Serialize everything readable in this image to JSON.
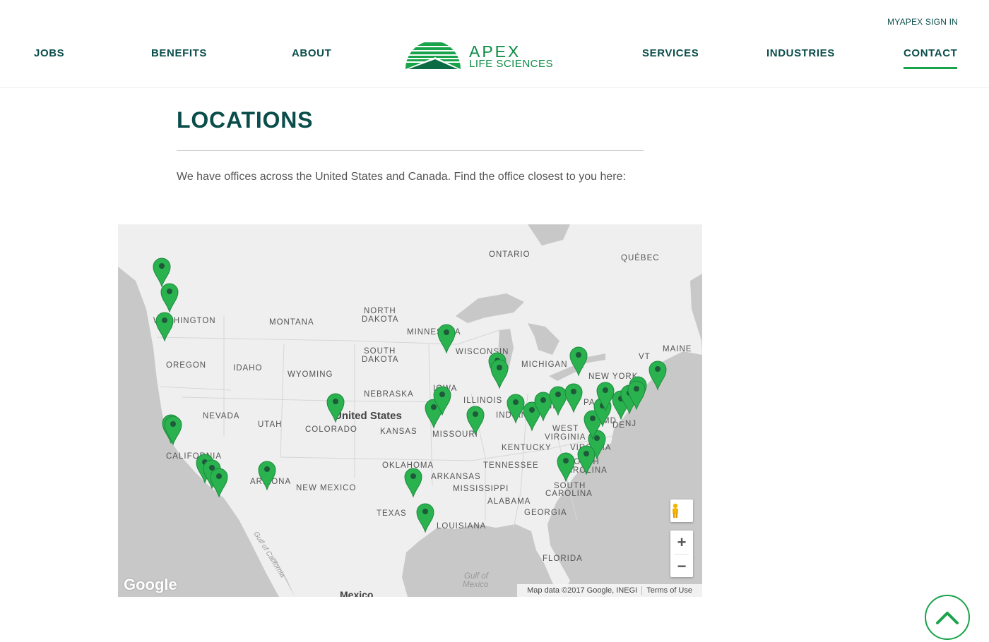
{
  "header": {
    "signin": "MYAPEX SIGN IN",
    "nav": {
      "jobs": "JOBS",
      "benefits": "BENEFITS",
      "about": "ABOUT",
      "services": "SERVICES",
      "industries": "INDUSTRIES",
      "contact": "CONTACT"
    },
    "logo": {
      "line1": "APEX",
      "line2": "LIFE SCIENCES"
    }
  },
  "main": {
    "title": "LOCATIONS",
    "intro": "We have offices across the United States and Canada. Find the office closest to you here:"
  },
  "map": {
    "labels": {
      "ontario": "ONTARIO",
      "quebec": "QUÉBEC",
      "washington": "WASHINGTON",
      "montana": "MONTANA",
      "north_dakota_1": "NORTH",
      "north_dakota_2": "DAKOTA",
      "minnesota": "MINNESOTA",
      "south_dakota_1": "SOUTH",
      "south_dakota_2": "DAKOTA",
      "wisconsin": "WISCONSIN",
      "michigan": "MICHIGAN",
      "maine": "MAINE",
      "vt": "VT",
      "oregon": "OREGON",
      "idaho": "IDAHO",
      "wyoming": "WYOMING",
      "new_york": "NEW YORK",
      "iowa": "IOWA",
      "nebraska": "NEBRASKA",
      "illinois": "ILLINOIS",
      "ohio": "OHIO",
      "pa": "PA",
      "nevada": "NEVADA",
      "united_states": "United States",
      "utah": "UTAH",
      "colorado": "COLORADO",
      "kansas": "KANSAS",
      "missouri": "MISSOURI",
      "indiana": "INDIANA",
      "west_virginia_1": "WEST",
      "west_virginia_2": "VIRGINIA",
      "md": "MD",
      "de": "DE",
      "nj": "NJ",
      "kentucky": "KENTUCKY",
      "virginia": "VIRGINIA",
      "california": "CALIFORNIA",
      "oklahoma": "OKLAHOMA",
      "tennessee": "TENNESSEE",
      "north_carolina_1": "NORTH",
      "north_carolina_2": "CAROLINA",
      "arizona": "ARIZONA",
      "arkansas": "ARKANSAS",
      "new_mexico": "NEW MEXICO",
      "mississippi": "MISSISSIPPI",
      "south_carolina_1": "SOUTH",
      "south_carolina_2": "CAROLINA",
      "alabama": "ALABAMA",
      "texas": "TEXAS",
      "georgia": "GEORGIA",
      "louisiana": "LOUISIANA",
      "florida": "FLORIDA",
      "gulf_mexico_1": "Gulf of",
      "gulf_mexico_2": "Mexico",
      "gulf_california": "Gulf of California",
      "mexico": "Mexico"
    },
    "google_logo": "Google",
    "attribution": "Map data ©2017 Google, INEGI",
    "terms": "Terms of Use",
    "zoom_in": "+",
    "zoom_out": "−",
    "marker_color": "#2ab24f",
    "marker_dot_color": "#1e5a3a"
  },
  "colors": {
    "brand_dark": "#0a4d4a",
    "brand_green": "#1aa34a"
  }
}
